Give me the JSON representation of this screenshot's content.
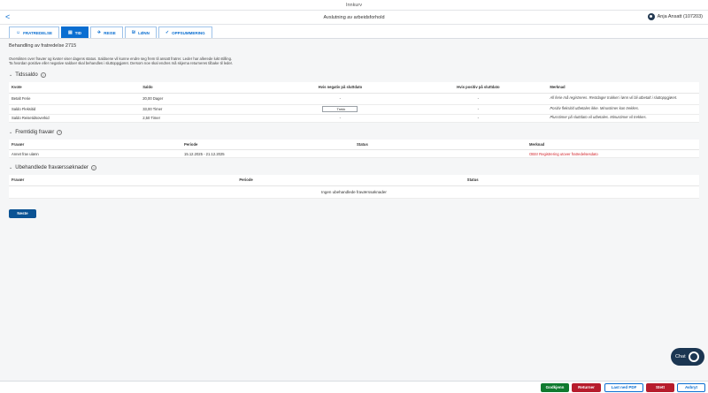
{
  "app": {
    "title": "Innkurv"
  },
  "header": {
    "back_label": "<",
    "title": "Avslutning av arbeidsforhold",
    "user_name": "Anja Ansatt (107203)"
  },
  "tabs": [
    {
      "label": "FRATREDELSE",
      "icon": "person-icon"
    },
    {
      "label": "TID",
      "icon": "calendar-icon"
    },
    {
      "label": "REISE",
      "icon": "travel-icon"
    },
    {
      "label": "LØNN",
      "icon": "money-icon"
    },
    {
      "label": "OPPSUMMERING",
      "icon": "check-icon"
    }
  ],
  "page": {
    "heading": "Behandling av fratredelse 2715",
    "intro_line1": "Oversikten over fravær og kvoter viser dagens status. Saldoene vil kunne endre seg frem til ansatt fratrer. Leder har allerede lukt stilling.",
    "intro_line2": "Ta hvordan positive eller negative saldoer skal behandles i sluttoppgjøret. Dersom noe skal endres må skjema returneres tilbake til leder."
  },
  "tidssaldo": {
    "title": "Tidssaldo",
    "columns": [
      "Kvote",
      "Saldo",
      "Hvis negativ på sluttdato",
      "Hvis positiv på sluttdato",
      "Merknad"
    ],
    "rows": [
      {
        "kvote": "Betalt Ferie",
        "saldo": "20,00 Dager",
        "neg": "-",
        "pos": "-",
        "merknad": "All ferie må registreres. Restdager trukket i lønn vil bli utbetalt i sluttoppgjøret."
      },
      {
        "kvote": "Saldo Fleksitid",
        "saldo": "33,00 Timer",
        "neg": "Trekk",
        "pos": "-",
        "merknad": "Positiv fleksitid utbetales ikke. Minustimer kan trekkes."
      },
      {
        "kvote": "Saldo Reisetidsoverkid",
        "saldo": "2,50 Timer",
        "neg": "-",
        "pos": "-",
        "merknad": "Plusstimer på sluttdato vil utbetales. Minustimer vil trekkes."
      }
    ]
  },
  "fravaer": {
    "title": "Fremtidig fravær",
    "columns": [
      "Fravær",
      "Periode",
      "Status",
      "Merknad"
    ],
    "rows": [
      {
        "fravaer": "Annet frav ulønn",
        "periode": "15.12.2025 - 21.12.2025",
        "status": "",
        "merknad": "OBS! Registrering utover fratredelsesdato"
      }
    ]
  },
  "soknader": {
    "title": "Ubehandlede fraværssøknader",
    "columns": [
      "Fravær",
      "Periode",
      "Status"
    ],
    "empty": "Ingen ubehandlede fraværssøknader"
  },
  "neste_label": "Neste",
  "chat_label": "Chat",
  "footer": {
    "approve": "Godkjenn",
    "return": "Returner",
    "pdf": "Last ned PDF",
    "stop": "Stett",
    "cancel": "Avbryt"
  },
  "colors": {
    "primary": "#0a6ed1",
    "approve": "#0f7a2f",
    "danger": "#b71c2c",
    "warning_text": "#d2232a"
  }
}
